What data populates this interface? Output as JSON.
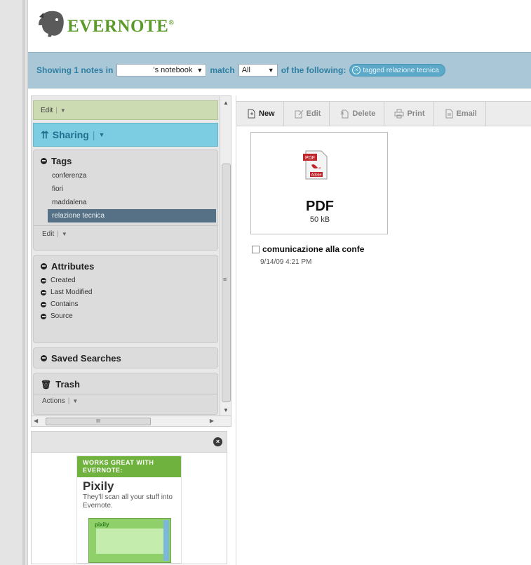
{
  "app": {
    "logo_text": "EVERNOTE",
    "logo_mark": "®",
    "brand_color": "#5c9a2a"
  },
  "filter_bar": {
    "showing_label": "Showing 1 notes in",
    "notebook_value": "'s notebook",
    "match_label": "match",
    "match_value": "All",
    "of_following_label": "of the following:",
    "tag_filter": "tagged relazione tecnica",
    "bar_color": "#a9c7d6"
  },
  "sidebar": {
    "edit_label": "Edit",
    "sharing_label": "Sharing",
    "tags": {
      "title": "Tags",
      "items": [
        {
          "label": "conferenza",
          "selected": false
        },
        {
          "label": "fiori",
          "selected": false
        },
        {
          "label": "maddalena",
          "selected": false
        },
        {
          "label": "relazione tecnica",
          "selected": true
        }
      ],
      "edit_label": "Edit"
    },
    "attributes": {
      "title": "Attributes",
      "items": [
        "Created",
        "Last Modified",
        "Contains",
        "Source"
      ]
    },
    "saved_searches": {
      "title": "Saved Searches"
    },
    "trash": {
      "title": "Trash",
      "actions_label": "Actions"
    },
    "h_scroll_grip": "III"
  },
  "ad": {
    "headline": "WORKS GREAT WITH EVERNOTE:",
    "name": "Pixily",
    "description": "They'll scan all your stuff into Evernote.",
    "shot_logo": "pixily"
  },
  "toolbar": {
    "buttons": [
      {
        "label": "New",
        "icon": "new-note-icon",
        "active": true
      },
      {
        "label": "Edit",
        "icon": "edit-icon",
        "active": false
      },
      {
        "label": "Delete",
        "icon": "delete-icon",
        "active": false
      },
      {
        "label": "Print",
        "icon": "print-icon",
        "active": false
      },
      {
        "label": "Email",
        "icon": "email-icon",
        "active": false
      }
    ]
  },
  "notes": [
    {
      "thumb_type": "PDF",
      "thumb_size": "50 kB",
      "thumb_icon_label": "PDF",
      "thumb_icon_sub": "Adobe",
      "title": "comunicazione alla confe",
      "date": "9/14/09 4:21 PM"
    }
  ]
}
